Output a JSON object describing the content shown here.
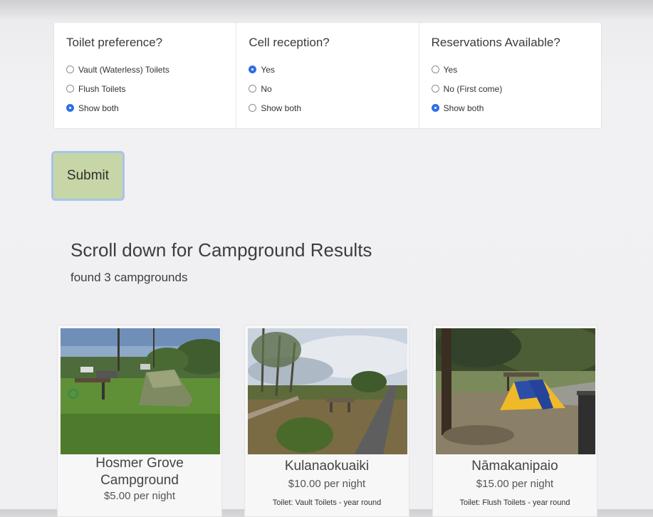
{
  "filters": [
    {
      "title": "Toilet preference?",
      "options": [
        {
          "label": "Vault (Waterless) Toilets",
          "checked": false
        },
        {
          "label": "Flush Toilets",
          "checked": false
        },
        {
          "label": "Show both",
          "checked": true
        }
      ]
    },
    {
      "title": "Cell reception?",
      "options": [
        {
          "label": "Yes",
          "checked": true
        },
        {
          "label": "No",
          "checked": false
        },
        {
          "label": "Show both",
          "checked": false
        }
      ]
    },
    {
      "title": "Reservations Available?",
      "options": [
        {
          "label": "Yes",
          "checked": false
        },
        {
          "label": "No (First come)",
          "checked": false
        },
        {
          "label": "Show both",
          "checked": true
        }
      ]
    }
  ],
  "submit_label": "Submit",
  "results": {
    "title": "Scroll down for Campground Results",
    "count": "found 3 campgrounds"
  },
  "campgrounds": [
    {
      "name_line1": "Hosmer Grove",
      "name_line2": "Campground",
      "price": "$5.00 per night",
      "toilet": ""
    },
    {
      "name_line1": "Kulanaokuaiki",
      "name_line2": "",
      "price": "$10.00 per night",
      "toilet": "Toilet: Vault Toilets - year round"
    },
    {
      "name_line1": "Nāmakanipaio",
      "name_line2": "",
      "price": "$15.00 per night",
      "toilet": "Toilet: Flush Toilets - year round"
    }
  ],
  "colors": {
    "submit_bg": "#c7d6a6",
    "submit_border": "#a8c4ea",
    "radio_checked": "#2f6fe6"
  }
}
